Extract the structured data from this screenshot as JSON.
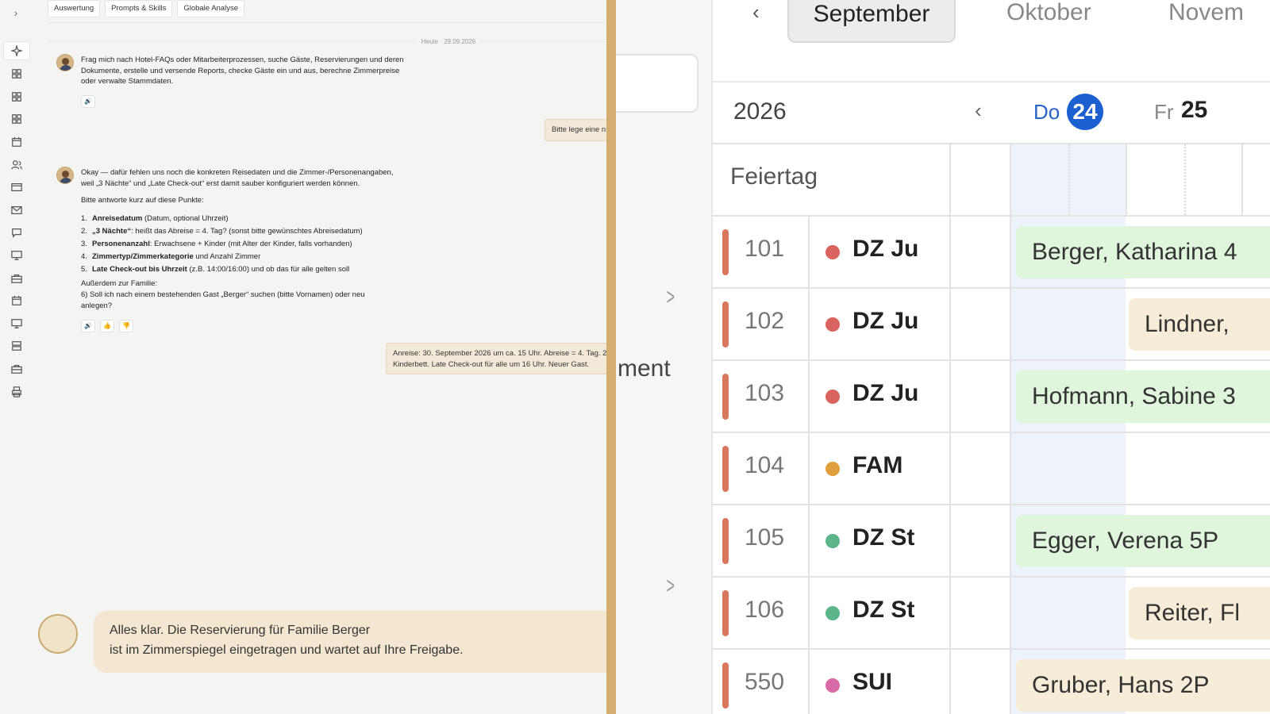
{
  "left": {
    "tabs": [
      "Auswertung",
      "Prompts & Skills",
      "Globale Analyse"
    ],
    "date_separator": "Heute · 29.09.2026",
    "intro_message": "Frag mich nach Hotel-FAQs oder Mitarbeiterprozessen, suche Gäste, Reservierungen und deren Dokumente, erstelle und versende Reports, checke Gäste ein und aus, berechne Zimmerpreise oder verwalte Stammdaten.",
    "user_message_1": "Bitte lege eine n",
    "reply": {
      "intro": "Okay — dafür fehlen uns noch die konkreten Reisedaten und die Zimmer-/Personenangaben, weil „3 Nächte“ und „Late Check-out“ erst damit sauber konfiguriert werden können.",
      "ask": "Bitte antworte kurz auf diese Punkte:",
      "items": [
        {
          "num": "1.",
          "bold": "Anreisedatum",
          "rest": " (Datum, optional Uhrzeit)"
        },
        {
          "num": "2.",
          "bold": "„3 Nächte“",
          "rest": ": heißt das Abreise = 4. Tag? (sonst bitte gewünschtes Abreisedatum)"
        },
        {
          "num": "3.",
          "bold": "Personenanzahl",
          "rest": ": Erwachsene + Kinder (mit Alter der Kinder, falls vorhanden)"
        },
        {
          "num": "4.",
          "bold": "Zimmertyp/Zimmerkategorie",
          "rest": " und Anzahl Zimmer"
        },
        {
          "num": "5.",
          "bold": "Late Check-out bis Uhrzeit",
          "rest": " (z.B. 14:00/16:00) und ob das für alle gelten soll"
        }
      ],
      "family_label": "Außerdem zur Familie:",
      "family_q": "6) Soll ich nach einem bestehenden Gast „Berger“ suchen (bitte Vornamen) oder neu anlegen?"
    },
    "user_message_2_line1": "Anreise: 30. September 2026 um ca. 15 Uhr. Abreise = 4. Tag. 2",
    "user_message_2_line2": "Kinderbett. Late Check-out für alle um 16 Uhr. Neuer Gast.",
    "final_message_line1": "Alles klar. Die Reservierung für Familie Berger",
    "final_message_line2": "ist im Zimmerspiegel eingetragen und wartet auf Ihre Freigabe.",
    "sidebar_icons": [
      "sparkle-icon",
      "dashboard-icon",
      "dashboard-icon",
      "dashboard-icon",
      "calendar-icon",
      "users-icon",
      "card-icon",
      "mail-icon",
      "chat-icon",
      "monitor-icon",
      "briefcase-icon",
      "calendar-icon",
      "monitor-icon",
      "server-icon",
      "briefcase-icon",
      "printer-icon"
    ]
  },
  "middle": {
    "partial_text": "ment"
  },
  "calendar": {
    "months": [
      "September",
      "Oktober",
      "Novem"
    ],
    "active_month": "September",
    "year": "2026",
    "day1_name": "Do",
    "day1_num": "24",
    "day2_name": "Fr",
    "day2_num": "25",
    "holiday_label": "Feiertag",
    "rooms": [
      {
        "no": "101",
        "cat": "DZ Ju",
        "color": "#d9645f",
        "guest": "Berger, Katharina 4",
        "style": "green",
        "offset": 0
      },
      {
        "no": "102",
        "cat": "DZ Ju",
        "color": "#d9645f",
        "guest": "Lindner, ",
        "style": "beige",
        "offset": 1
      },
      {
        "no": "103",
        "cat": "DZ Ju",
        "color": "#d9645f",
        "guest": "Hofmann, Sabine 3",
        "style": "green",
        "offset": 0
      },
      {
        "no": "104",
        "cat": "FAM",
        "color": "#e0a03f",
        "guest": "",
        "style": "",
        "offset": 0
      },
      {
        "no": "105",
        "cat": "DZ St",
        "color": "#5cb58a",
        "guest": "Egger, Verena 5P",
        "style": "green",
        "offset": 0
      },
      {
        "no": "106",
        "cat": "DZ St",
        "color": "#5cb58a",
        "guest": "Reiter, Fl",
        "style": "beige",
        "offset": 1
      },
      {
        "no": "550",
        "cat": "SUI",
        "color": "#d96aa8",
        "guest": "Gruber, Hans 2P",
        "style": "beige",
        "offset": 0
      }
    ]
  }
}
